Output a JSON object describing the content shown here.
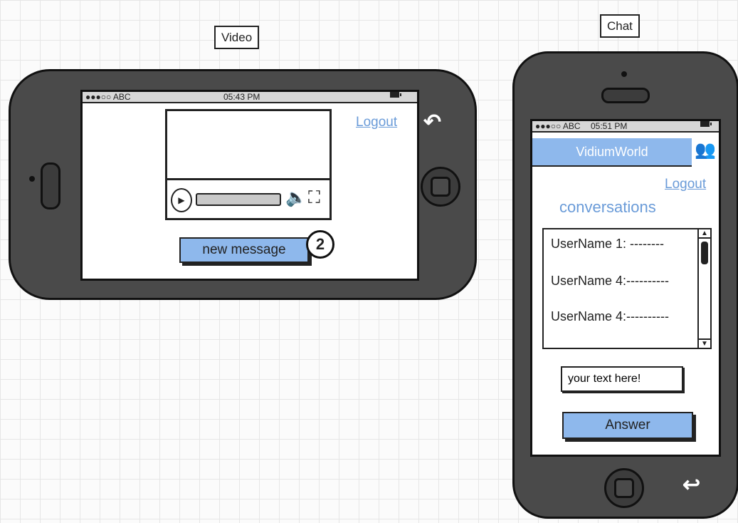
{
  "labels": {
    "video": "Video",
    "chat": "Chat"
  },
  "video_screen": {
    "status": {
      "carrier": "●●●○○ ABC",
      "time": "05:43 PM"
    },
    "logout_link": "Logout",
    "player": {
      "play_icon": "play-icon",
      "volume_icon": "volume-icon",
      "fullscreen_icon": "fullscreen-icon"
    },
    "new_message_button": "new message",
    "notification_badge": "2",
    "rotate_icon": "rotate-icon"
  },
  "chat_screen": {
    "status": {
      "carrier": "●●●○○ ABC",
      "time": "05:51 PM"
    },
    "header_title": "VidiumWorld",
    "group_icon": "users-icon",
    "logout_link": "Logout",
    "conversations_title": "conversations",
    "messages": [
      "UserName 1: --------",
      "UserName 4:----------",
      "UserName 4:----------"
    ],
    "text_input_value": "your text here!",
    "answer_button": "Answer",
    "back_icon": "back-arrow-icon"
  },
  "colors": {
    "accent": "#8eb8ec",
    "link": "#6a9bd8",
    "device": "#4a4a4a"
  }
}
